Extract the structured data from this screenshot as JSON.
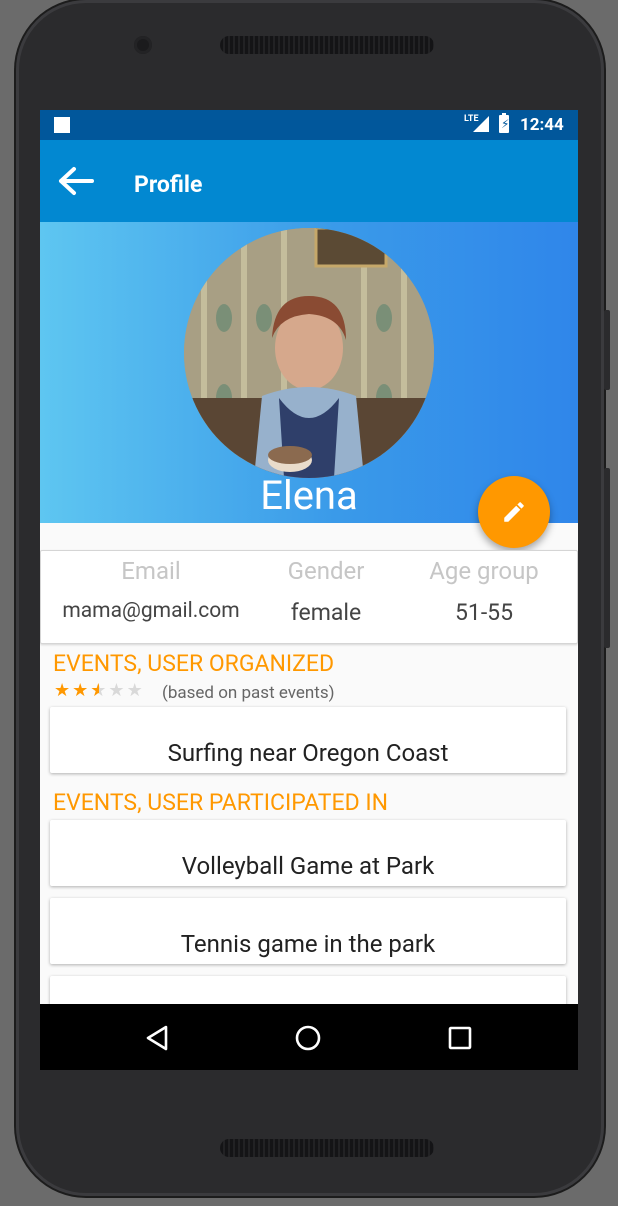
{
  "status_bar": {
    "network": "LTE",
    "time": "12:44"
  },
  "toolbar": {
    "title": "Profile",
    "back_icon": "arrow-back-icon"
  },
  "profile": {
    "name": "Elena",
    "edit_icon": "pencil-icon"
  },
  "info": {
    "headers": [
      "Email",
      "Gender",
      "Age group"
    ],
    "values": [
      "mama@gmail.com",
      "female",
      "51-55"
    ]
  },
  "organized": {
    "title": "EVENTS, USER ORGANIZED",
    "rating_stars": 2.5,
    "rating_max": 5,
    "rating_note": "(based on past events)",
    "events": [
      "Surfing near Oregon Coast"
    ]
  },
  "participated": {
    "title": "EVENTS, USER PARTICIPATED IN",
    "events": [
      "Volleyball Game at Park",
      "Tennis game in the park",
      ""
    ]
  },
  "nav": {
    "back_icon": "triangle-back-icon",
    "home_icon": "circle-home-icon",
    "recents_icon": "square-recents-icon"
  },
  "colors": {
    "status": "#01579b",
    "toolbar": "#0288d1",
    "accent": "#ff9800"
  }
}
